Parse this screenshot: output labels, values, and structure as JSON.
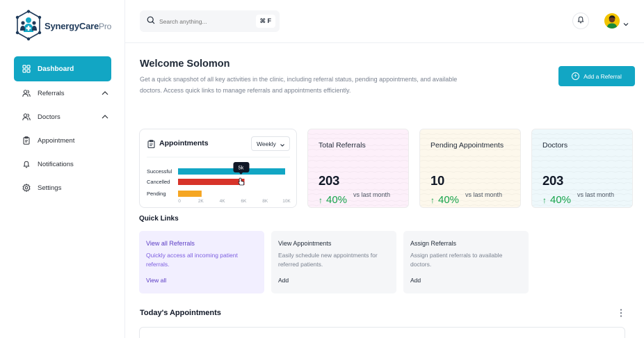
{
  "brand": {
    "name_main": "SynergyCare",
    "name_suffix": "Pro",
    "logo_icon": "medical-team-logo"
  },
  "sidebar": {
    "items": [
      {
        "label": "Dashboard",
        "icon": "grid-icon",
        "active": true
      },
      {
        "label": "Referrals",
        "icon": "users-icon",
        "expandable": true
      },
      {
        "label": "Doctors",
        "icon": "users-icon",
        "expandable": true
      },
      {
        "label": "Appointment",
        "icon": "clipboard-icon"
      },
      {
        "label": "Notifications",
        "icon": "bell-icon"
      },
      {
        "label": "Settings",
        "icon": "gear-icon"
      }
    ]
  },
  "search": {
    "placeholder": "Search anything...",
    "shortcut": "⌘ F"
  },
  "header": {
    "welcome": "Welcome Solomon",
    "description": "Get a quick snapshot of all key activities in the clinic, including referral status, pending appointments, and available doctors. Access quick links to manage referrals and appointments efficiently.",
    "add_referral": "Add a Referral"
  },
  "appointments_card": {
    "title": "Appointments",
    "period": "Weekly"
  },
  "chart_data": {
    "type": "bar",
    "orientation": "horizontal",
    "categories": [
      "Successful",
      "Cancelled",
      "Pending"
    ],
    "values": [
      10000,
      6200,
      2200
    ],
    "colors": [
      "#12a6c4",
      "#d7332a",
      "#f5a623"
    ],
    "xticks": [
      "0",
      "2K",
      "4K",
      "6K",
      "8K",
      "10K"
    ],
    "xlim": [
      0,
      10000
    ],
    "tooltip": {
      "category": "Cancelled",
      "label": "5k"
    }
  },
  "stats": [
    {
      "label": "Total Referrals",
      "value": "203",
      "change": "40%",
      "compare": "vs last month",
      "bg": "#fdf0fa"
    },
    {
      "label": "Pending Appointments",
      "value": "10",
      "change": "40%",
      "compare": "vs last month",
      "bg": "#fdf8ec"
    },
    {
      "label": "Doctors",
      "value": "203",
      "change": "40%",
      "compare": "vs last month",
      "bg": "#eef8fb"
    }
  ],
  "quick_links": {
    "title": "Quick Links",
    "items": [
      {
        "title": "View all Referrals",
        "desc": "Quickly access all incoming patient referrals.",
        "action": "View all"
      },
      {
        "title": "View Appointments",
        "desc": "Easily schedule new appointments for referred patients.",
        "action": "Add"
      },
      {
        "title": "Assign Referrals",
        "desc": "Assign patient referrals to available doctors.",
        "action": "Add"
      }
    ]
  },
  "today": {
    "title": "Today's Appointments"
  },
  "colors": {
    "accent": "#12a6c4",
    "success": "#16a34a"
  }
}
